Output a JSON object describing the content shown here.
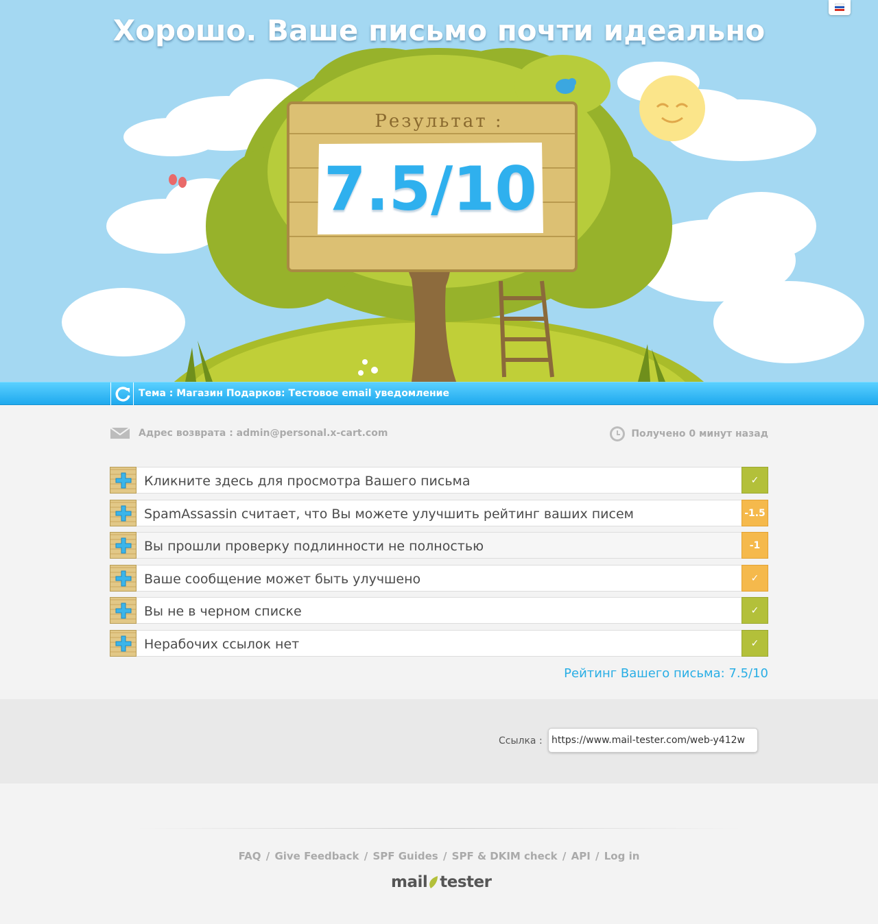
{
  "hero": {
    "headline": "Хорошо. Ваше письмо почти идеально",
    "board_title": "Результат :",
    "score": "7.5/10"
  },
  "language": {
    "current": "ru",
    "icon": "russian-flag-icon"
  },
  "subject_bar": {
    "refresh_icon": "refresh-icon",
    "subject": "Тема : Магазин Подарков: Тестовое email уведомление"
  },
  "info": {
    "return_address": "Адрес возврата : admin@personal.x-cart.com",
    "received": "Получено 0 минут назад"
  },
  "results": [
    {
      "label": "Кликните здесь для просмотра Вашего письма",
      "badge": "✓",
      "status": "green"
    },
    {
      "label": "SpamAssassin считает, что Вы можете улучшить рейтинг ваших писем",
      "badge": "-1.5",
      "status": "orange"
    },
    {
      "label": "Вы прошли проверку подлинности не полностью",
      "badge": "-1",
      "status": "orange"
    },
    {
      "label": "Ваше сообщение может быть улучшено",
      "badge": "✓",
      "status": "orange"
    },
    {
      "label": "Вы не в черном списке",
      "badge": "✓",
      "status": "green"
    },
    {
      "label": "Нерабочих ссылок нет",
      "badge": "✓",
      "status": "green"
    }
  ],
  "rating_line": "Рейтинг Вашего письма: 7.5/10",
  "link": {
    "label": "Ссылка :",
    "value": "https://www.mail-tester.com/web-y412w"
  },
  "footer": {
    "links": [
      "FAQ",
      "Give Feedback",
      "SPF Guides",
      "SPF & DKIM check",
      "API",
      "Log in"
    ],
    "separator": "/",
    "logo_left": "mail",
    "logo_right": "tester"
  },
  "colors": {
    "sky": "#a4d8f2",
    "accent_blue": "#29aee5",
    "ok_green": "#b3c03a",
    "warn_orange": "#f5b94c"
  }
}
